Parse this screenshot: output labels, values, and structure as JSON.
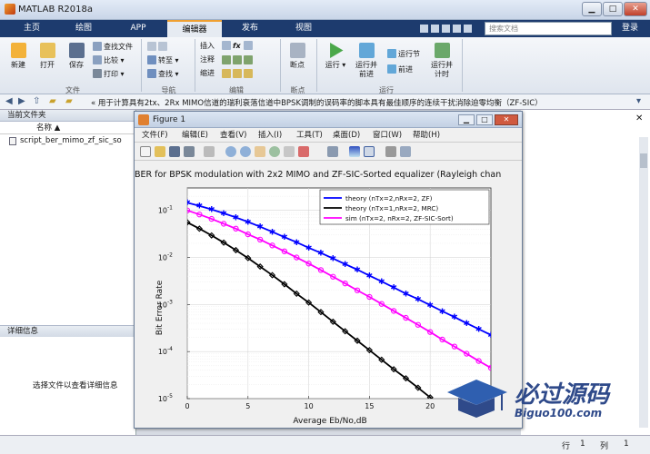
{
  "app": {
    "title": "MATLAB R2018a"
  },
  "tabs": [
    "主页",
    "绘图",
    "APP",
    "编辑器",
    "发布",
    "视图"
  ],
  "search": {
    "placeholder": "搜索文档"
  },
  "login_label": "登录",
  "ribbon": {
    "file_group": {
      "label": "文件",
      "new": "新建",
      "open": "打开",
      "save": "保存",
      "find_files": "查找文件",
      "compare": "比较",
      "print": "打印"
    },
    "nav_group": {
      "label": "导航",
      "goto": "转至",
      "find": "查找"
    },
    "edit_group": {
      "label": "编辑",
      "insert": "插入",
      "comment": "注释",
      "indent": "缩进",
      "fx": "fx"
    },
    "breakpoint_group": {
      "label": "断点",
      "breakpoints": "断点"
    },
    "run_group": {
      "label": "运行",
      "run": "运行",
      "run_advance": "运行并\n前进",
      "run_section": "运行节",
      "advance": "前进",
      "run_time": "运行并\n计时"
    }
  },
  "address_bar": {
    "path": "« 用于计算具有2tx、2Rx MIMO信道的瑞利衰落信道中BPSK调制的误码率的脚本具有最佳顺序的连续干扰消除迫零均衡（ZF-SIC）"
  },
  "current_folder": {
    "title": "当前文件夹",
    "column": "名称 ▲",
    "files": [
      "script_ber_mimo_zf_sic_so"
    ]
  },
  "details": {
    "title": "详细信息",
    "message": "选择文件以查看详细信息"
  },
  "statusbar": {
    "row_label": "行",
    "row_value": "1",
    "col_label": "列",
    "col_value": "1"
  },
  "figure": {
    "title": "Figure 1",
    "menu": [
      "文件(F)",
      "编辑(E)",
      "查看(V)",
      "插入(I)",
      "工具(T)",
      "桌面(D)",
      "窗口(W)",
      "帮助(H)"
    ],
    "plot_title": "BER for BPSK modulation with 2x2 MIMO and ZF-SIC-Sorted equalizer (Rayleigh chan",
    "xlabel": "Average Eb/No,dB",
    "ylabel": "Bit Error Rate"
  },
  "watermark": {
    "main": "必过源码",
    "sub": "Biguo100.com"
  },
  "colors": {
    "theory_zf": "#0000ff",
    "theory_mrc": "#000000",
    "sim_zf_sic_sort": "#ff00ff",
    "tab_active_accent": "#f0a030"
  },
  "chart_data": {
    "type": "line",
    "title": "BER for BPSK modulation with 2x2 MIMO and ZF-SIC-Sorted equalizer (Rayleigh chan",
    "xlabel": "Average Eb/No,dB",
    "ylabel": "Bit Error Rate",
    "yscale": "log",
    "xlim": [
      0,
      25
    ],
    "ylim": [
      1e-05,
      0.3
    ],
    "xticks": [
      0,
      5,
      10,
      15,
      20
    ],
    "yticks": [
      "10^-5",
      "10^-4",
      "10^-3",
      "10^-2",
      "10^-1"
    ],
    "grid": true,
    "legend_position": "top-right",
    "x": [
      0,
      1,
      2,
      3,
      4,
      5,
      6,
      7,
      8,
      9,
      10,
      11,
      12,
      13,
      14,
      15,
      16,
      17,
      18,
      19,
      20,
      21,
      22,
      23,
      24,
      25
    ],
    "series": [
      {
        "name": "theory (nTx=2,nRx=2, ZF)",
        "marker": "star",
        "values": [
          0.146,
          0.125,
          0.105,
          0.087,
          0.071,
          0.057,
          0.045,
          0.035,
          0.027,
          0.021,
          0.016,
          0.0125,
          0.0095,
          0.0072,
          0.0055,
          0.0041,
          0.0031,
          0.0023,
          0.0017,
          0.0013,
          0.00097,
          0.00072,
          0.00054,
          0.0004,
          0.0003,
          0.000225
        ]
      },
      {
        "name": "theory (nTx=1,nRx=2, MRC)",
        "marker": "diamond",
        "values": [
          0.0556,
          0.0409,
          0.0294,
          0.0207,
          0.0143,
          0.0097,
          0.0064,
          0.0042,
          0.0027,
          0.0017,
          0.0011,
          0.00069,
          0.00043,
          0.00027,
          0.00017,
          0.000107,
          6.7e-05,
          4.2e-05,
          2.7e-05,
          1.7e-05,
          1.06e-05,
          6.7e-06,
          4.2e-06,
          2.7e-06,
          1.7e-06,
          1.1e-06
        ]
      },
      {
        "name": "sim (nTx=2, nRx=2, ZF-SIC-Sort)",
        "marker": "circle",
        "values": [
          0.1,
          0.082,
          0.066,
          0.052,
          0.041,
          0.031,
          0.024,
          0.018,
          0.0135,
          0.01,
          0.0074,
          0.0054,
          0.0039,
          0.0028,
          0.002,
          0.00145,
          0.00103,
          0.00073,
          0.00052,
          0.00037,
          0.00026,
          0.00018,
          0.000128,
          9e-05,
          6.3e-05,
          4.5e-05
        ]
      }
    ]
  }
}
